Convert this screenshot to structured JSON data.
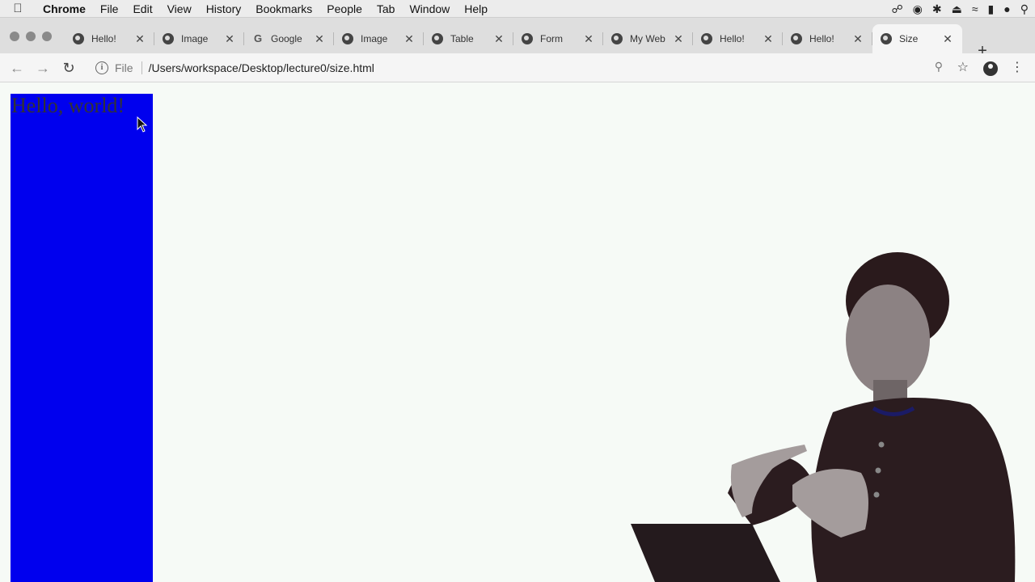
{
  "menubar": {
    "apple_icon": "apple-icon",
    "items": [
      "Chrome",
      "File",
      "Edit",
      "View",
      "History",
      "Bookmarks",
      "People",
      "Tab",
      "Window",
      "Help"
    ],
    "status_icons": [
      "glasses-icon",
      "circle-icon",
      "bluetooth-icon",
      "eject-icon",
      "wifi-icon",
      "battery-icon",
      "user-icon",
      "spotlight-icon"
    ]
  },
  "tabs": [
    {
      "title": "Hello!",
      "favicon": "globe-icon",
      "active": false
    },
    {
      "title": "Image",
      "favicon": "globe-icon",
      "active": false
    },
    {
      "title": "Google",
      "favicon": "google-icon",
      "active": false
    },
    {
      "title": "Image",
      "favicon": "globe-icon",
      "active": false
    },
    {
      "title": "Table",
      "favicon": "globe-icon",
      "active": false
    },
    {
      "title": "Form",
      "favicon": "globe-icon",
      "active": false
    },
    {
      "title": "My Web",
      "favicon": "globe-icon",
      "active": false
    },
    {
      "title": "Hello!",
      "favicon": "globe-icon",
      "active": false
    },
    {
      "title": "Hello!",
      "favicon": "globe-icon",
      "active": false
    },
    {
      "title": "Size",
      "favicon": "globe-icon",
      "active": true
    }
  ],
  "toolbar": {
    "scheme_label": "File",
    "url": "/Users/workspace/Desktop/lecture0/size.html"
  },
  "page": {
    "box_text": "Hello, world!",
    "box_color": "#0000ee"
  },
  "colors": {
    "page_background": "#f6faf6",
    "tabstrip": "#dedede",
    "toolbar": "#f5f5f5"
  }
}
